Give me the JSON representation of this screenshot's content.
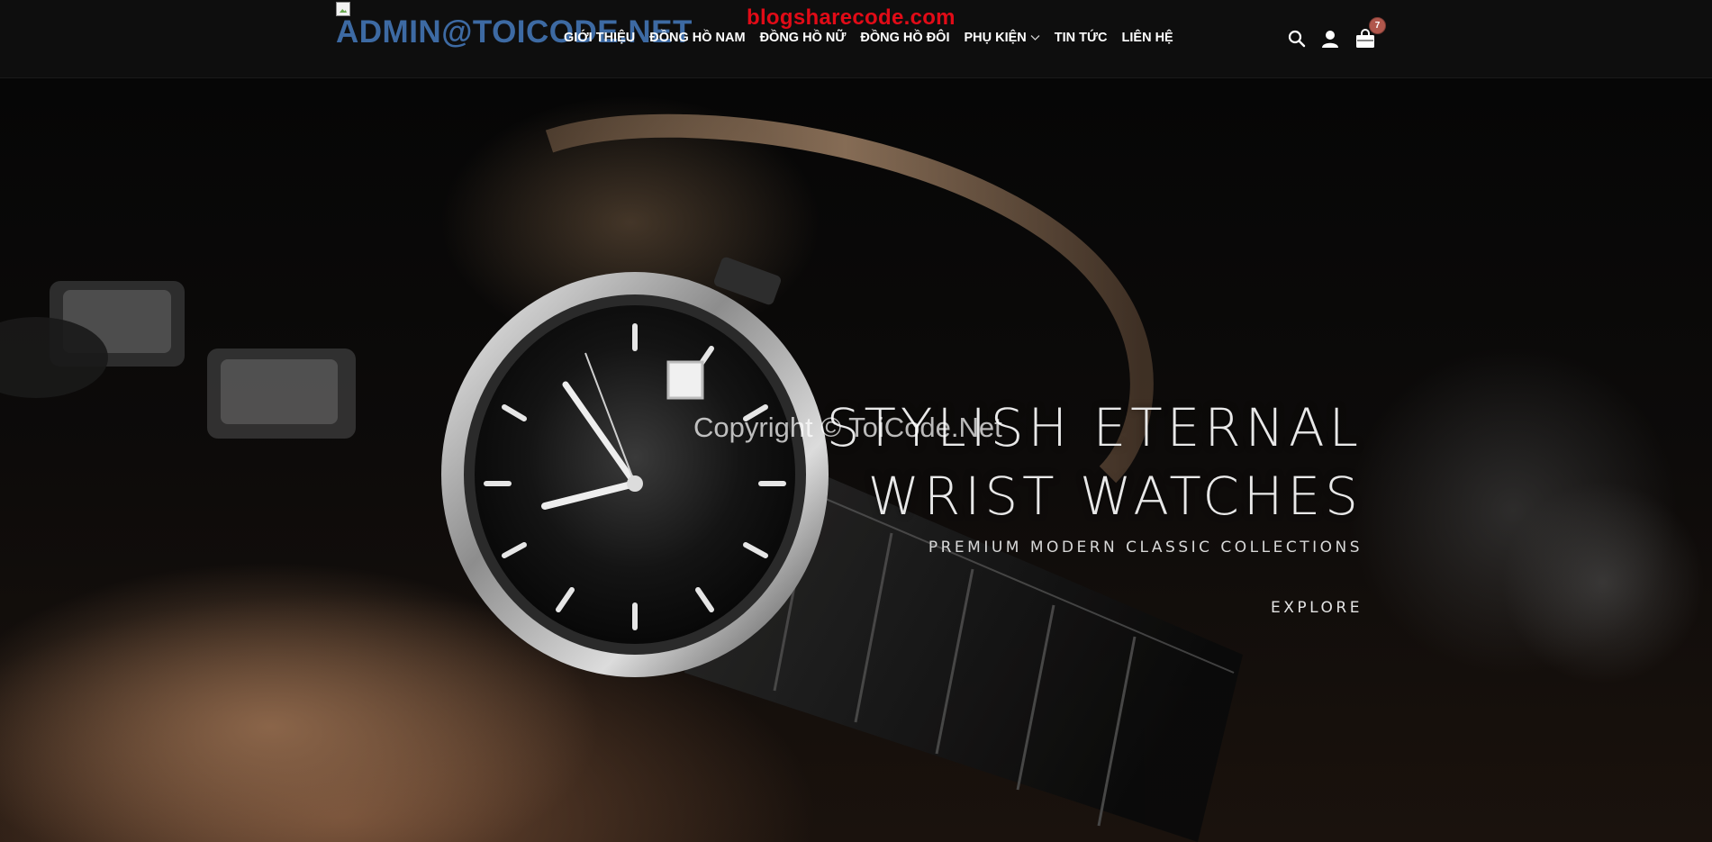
{
  "site": {
    "logo_text": "ADMIN@TOICODE.NET",
    "watermark_top": "blogsharecode.com",
    "watermark_center": "Copyright © ToiCode.Net"
  },
  "nav": {
    "items": [
      {
        "label": "GIỚI THIỆU"
      },
      {
        "label": "ĐỒNG HỒ NAM"
      },
      {
        "label": "ĐỒNG HỒ NỮ"
      },
      {
        "label": "ĐỒNG HỒ ĐÔI"
      },
      {
        "label": "PHỤ KIỆN",
        "has_dropdown": true
      },
      {
        "label": "TIN TỨC"
      },
      {
        "label": "LIÊN HỆ"
      }
    ]
  },
  "header_icons": {
    "search": "search-icon",
    "account": "user-icon",
    "cart": "shopping-bag-icon",
    "cart_count": "7"
  },
  "hero": {
    "title_line1": "STYLISH ETERNAL",
    "title_line2": "WRIST WATCHES",
    "subtitle": "PREMIUM MODERN CLASSIC COLLECTIONS",
    "cta": "EXPLORE"
  },
  "colors": {
    "header_bg": "#0e0e0e",
    "logo": "#3d6aa3",
    "watermark": "#e10b17",
    "badge": "#b0574c"
  }
}
